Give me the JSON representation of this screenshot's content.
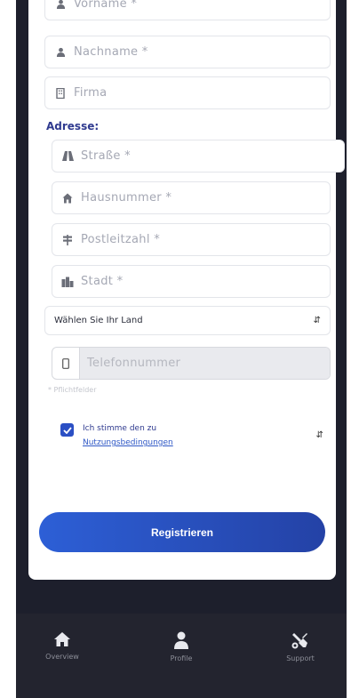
{
  "form": {
    "vorname_placeholder": "Vorname *",
    "nachname_placeholder": "Nachname *",
    "firma_placeholder": "Firma",
    "address_heading": "Adresse:",
    "strasse_placeholder": "Straße *",
    "hausnummer_placeholder": "Hausnummer *",
    "plz_placeholder": "Postleitzahl *",
    "stadt_placeholder": "Stadt *",
    "country_select": "Wählen Sie Ihr Land",
    "phone_placeholder": "Telefonnummer",
    "required_note": "* Pflichtfelder",
    "terms_line1": "Ich stimme den zu",
    "terms_link": "Nutzungsbedingungen",
    "terms_checked": true,
    "register_label": "Registrieren"
  },
  "tabs": [
    {
      "label": "Overview",
      "icon": "home-icon"
    },
    {
      "label": "Profile",
      "icon": "user-icon"
    },
    {
      "label": "Support",
      "icon": "tools-icon"
    }
  ],
  "colors": {
    "primary": "#2b4fc4",
    "heading": "#2f3a8f",
    "dark_bg": "#1d1f2c",
    "tabbar_bg": "#23242f"
  }
}
